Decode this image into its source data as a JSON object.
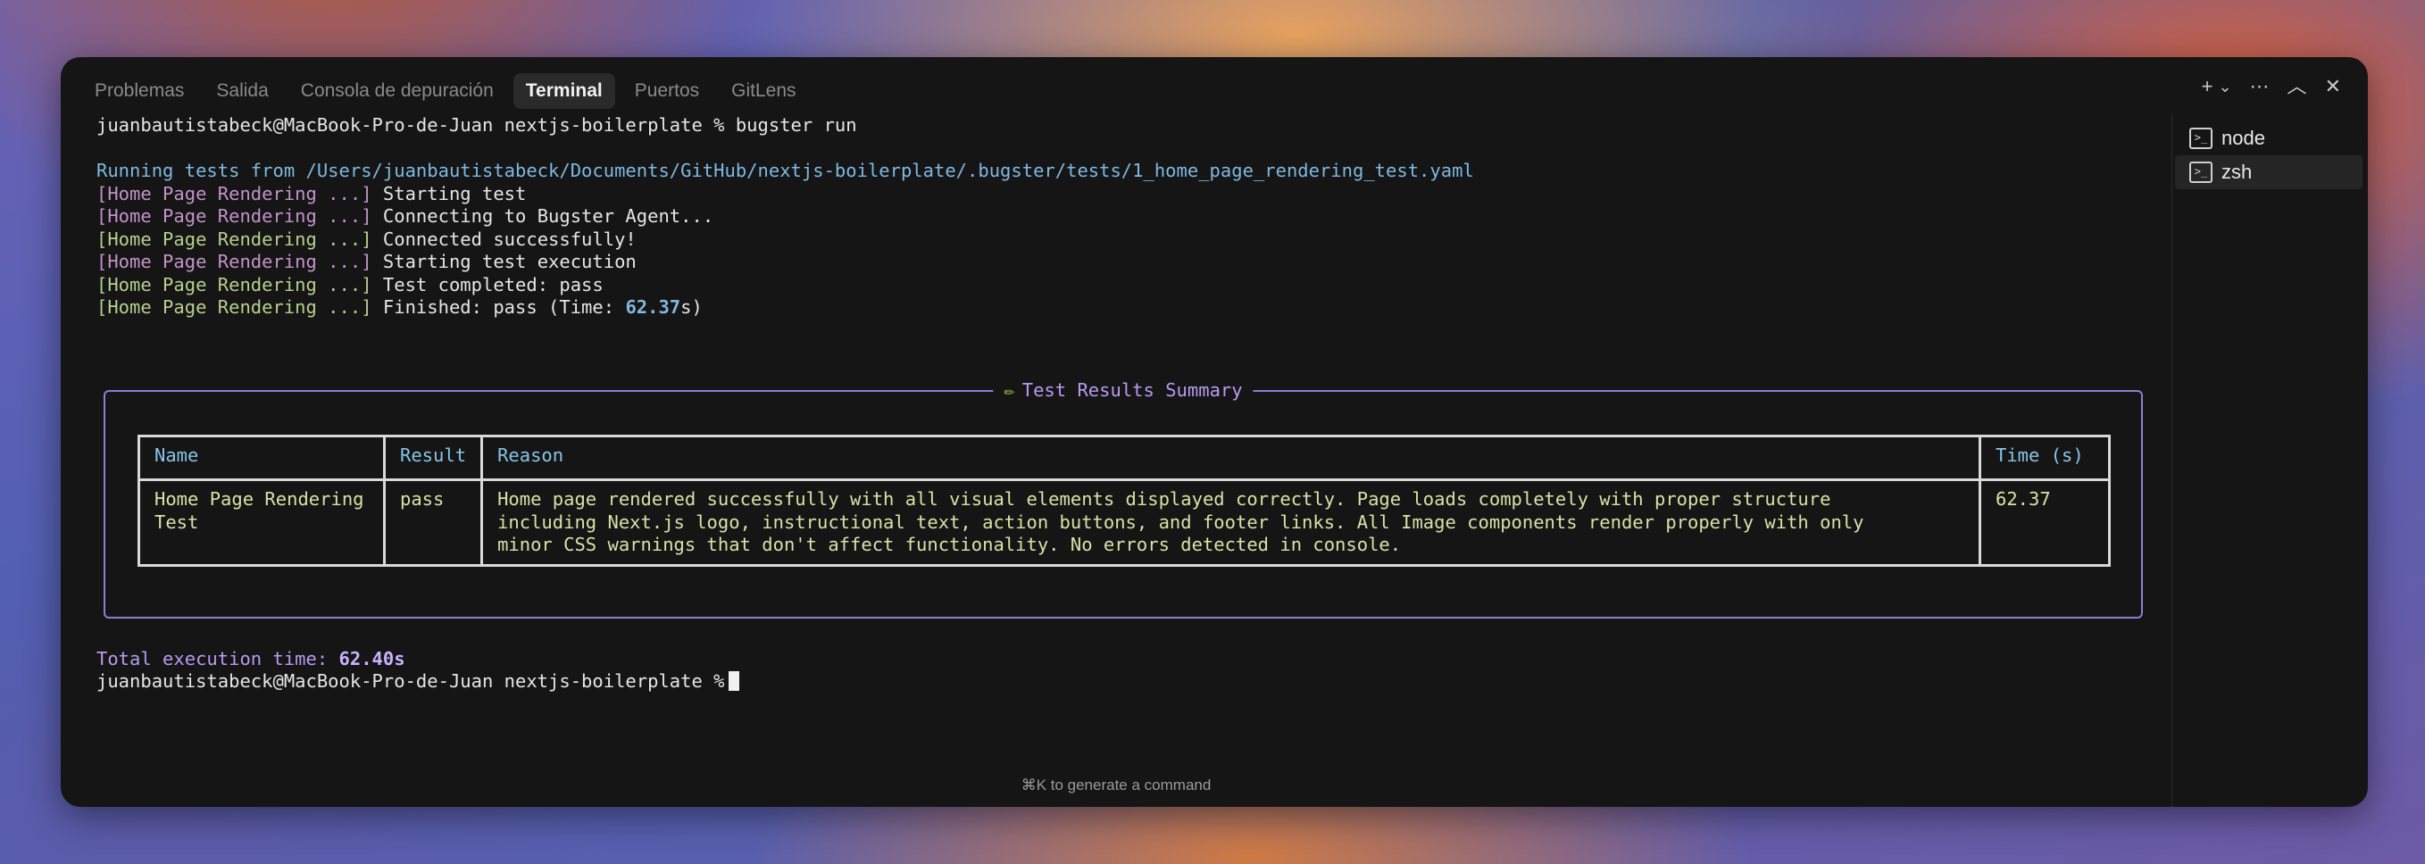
{
  "tabs": [
    {
      "label": "Problemas"
    },
    {
      "label": "Salida"
    },
    {
      "label": "Consola de depuración"
    },
    {
      "label": "Terminal",
      "active": true
    },
    {
      "label": "Puertos"
    },
    {
      "label": "GitLens"
    }
  ],
  "window_controls": {
    "add": "+",
    "dropdown": "⌄",
    "more": "⋯",
    "maximize": "︿",
    "close": "✕"
  },
  "terminal": {
    "prompt": "juanbautistabeck@MacBook-Pro-de-Juan nextjs-boilerplate %",
    "command": " bugster run",
    "running": "Running tests from /Users/juanbautistabeck/Documents/GitHub/nextjs-boilerplate/.bugster/tests/1_home_page_rendering_test.yaml",
    "log_prefix": "[Home Page Rendering ...]",
    "logs": [
      {
        "text": " Starting test"
      },
      {
        "text": " Connecting to Bugster Agent..."
      },
      {
        "text": " Connected successfully!"
      },
      {
        "text": " Starting test execution"
      },
      {
        "text": " Test completed: pass"
      }
    ],
    "finished_prefix": " Finished: pass (Time: ",
    "finished_time": "62.37",
    "finished_suffix": "s)",
    "summary_title": "Test Results Summary",
    "table": {
      "headers": [
        "Name",
        "Result",
        "Reason",
        "Time (s)"
      ],
      "rows": [
        {
          "name": "Home Page Rendering Test",
          "result": "pass",
          "reason": "Home page rendered successfully with all visual elements displayed correctly. Page loads completely with proper structure\nincluding Next.js logo, instructional text, action buttons, and footer links. All Image components render properly with only\nminor CSS warnings that don't affect functionality. No errors detected in console.",
          "time": "62.37"
        }
      ]
    },
    "total_label": "Total execution time: ",
    "total_value": "62.40s"
  },
  "side_panel": {
    "items": [
      {
        "label": "node"
      },
      {
        "label": "zsh",
        "active": true
      }
    ]
  },
  "hint": "⌘K to generate a command",
  "icons": {
    "pencil": "pencil-icon",
    "terminal": "terminal-icon"
  }
}
